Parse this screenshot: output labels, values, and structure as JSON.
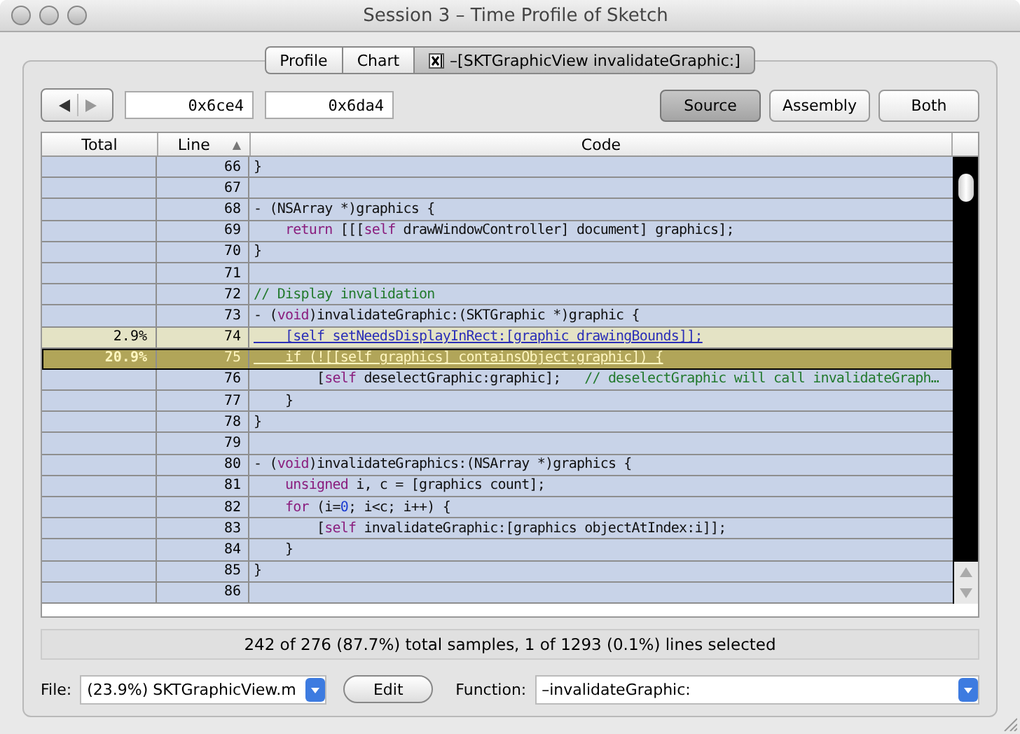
{
  "window": {
    "title": "Session 3 – Time Profile of Sketch"
  },
  "tabs": [
    {
      "label": "Profile",
      "selected": false,
      "closable": false
    },
    {
      "label": "Chart",
      "selected": false,
      "closable": false
    },
    {
      "label": "–[SKTGraphicView invalidateGraphic:]",
      "selected": true,
      "closable": true
    }
  ],
  "toolbar": {
    "address_from": "0x6ce4",
    "address_to": "0x6da4",
    "views": [
      {
        "label": "Source",
        "selected": true
      },
      {
        "label": "Assembly",
        "selected": false
      },
      {
        "label": "Both",
        "selected": false
      }
    ]
  },
  "table": {
    "columns": [
      {
        "label": "Total"
      },
      {
        "label": "Line",
        "sort": "▲"
      },
      {
        "label": "Code"
      }
    ],
    "rows": [
      {
        "line": "66",
        "selected": false,
        "sampled": false,
        "code": [
          {
            "text": "}",
            "kind": "plain"
          }
        ]
      },
      {
        "line": "67",
        "selected": false,
        "sampled": false
      },
      {
        "line": "68",
        "selected": false,
        "sampled": false,
        "code": [
          {
            "text": "- (NSArray *)graphics {",
            "kind": "plain"
          }
        ]
      },
      {
        "line": "69",
        "selected": false,
        "sampled": false,
        "code": [
          {
            "text": "    return",
            "kind": "keyword"
          },
          {
            "text": " [[[",
            "kind": "plain"
          },
          {
            "text": "self",
            "kind": "keyword"
          },
          {
            "text": " drawWindowController] document] graphics];",
            "kind": "plain"
          }
        ]
      },
      {
        "line": "70",
        "selected": false,
        "sampled": false,
        "code": [
          {
            "text": "}",
            "kind": "plain"
          }
        ]
      },
      {
        "line": "71",
        "selected": false,
        "sampled": false
      },
      {
        "line": "72",
        "selected": false,
        "sampled": false,
        "code": [
          {
            "text": "// Display invalidation",
            "kind": "comment"
          }
        ]
      },
      {
        "line": "73",
        "selected": false,
        "sampled": false,
        "code": [
          {
            "text": "- (",
            "kind": "plain"
          },
          {
            "text": "void",
            "kind": "keyword"
          },
          {
            "text": ")invalidateGraphic:(SKTGraphic *)graphic {",
            "kind": "plain"
          }
        ]
      },
      {
        "total": "2.9%",
        "line": "74",
        "selected": false,
        "sampled": true,
        "code": [
          {
            "text": "    [self setNeedsDisplayInRect:[graphic drawingBounds]];",
            "kind": "plain"
          }
        ]
      },
      {
        "total": "20.9%",
        "line": "75",
        "selected": true,
        "sampled": true,
        "code": [
          {
            "text": "    if (![[self graphics] containsObject:graphic]) {",
            "kind": "plain"
          }
        ]
      },
      {
        "line": "76",
        "selected": false,
        "sampled": false,
        "code": [
          {
            "text": "        [",
            "kind": "plain"
          },
          {
            "text": "self",
            "kind": "keyword"
          },
          {
            "text": " deselectGraphic:graphic];   ",
            "kind": "plain"
          },
          {
            "text": "// deselectGraphic will call invalidateGraph…",
            "kind": "comment"
          }
        ]
      },
      {
        "line": "77",
        "selected": false,
        "sampled": false,
        "code": [
          {
            "text": "    }",
            "kind": "plain"
          }
        ]
      },
      {
        "line": "78",
        "selected": false,
        "sampled": false,
        "code": [
          {
            "text": "}",
            "kind": "plain"
          }
        ]
      },
      {
        "line": "79",
        "selected": false,
        "sampled": false
      },
      {
        "line": "80",
        "selected": false,
        "sampled": false,
        "code": [
          {
            "text": "- (",
            "kind": "plain"
          },
          {
            "text": "void",
            "kind": "keyword"
          },
          {
            "text": ")invalidateGraphics:(NSArray *)graphics {",
            "kind": "plain"
          }
        ]
      },
      {
        "line": "81",
        "selected": false,
        "sampled": false,
        "code": [
          {
            "text": "    unsigned",
            "kind": "keyword"
          },
          {
            "text": " i, c = [graphics count];",
            "kind": "plain"
          }
        ]
      },
      {
        "line": "82",
        "selected": false,
        "sampled": false,
        "code": [
          {
            "text": "    for",
            "kind": "keyword"
          },
          {
            "text": " (i=",
            "kind": "plain"
          },
          {
            "text": "0",
            "kind": "number"
          },
          {
            "text": "; i<c; i++) {",
            "kind": "plain"
          }
        ]
      },
      {
        "line": "83",
        "selected": false,
        "sampled": false,
        "code": [
          {
            "text": "        [",
            "kind": "plain"
          },
          {
            "text": "self",
            "kind": "keyword"
          },
          {
            "text": " invalidateGraphic:[graphics objectAtIndex:i]];",
            "kind": "plain"
          }
        ]
      },
      {
        "line": "84",
        "selected": false,
        "sampled": false,
        "code": [
          {
            "text": "    }",
            "kind": "plain"
          }
        ]
      },
      {
        "line": "85",
        "selected": false,
        "sampled": false,
        "code": [
          {
            "text": "}",
            "kind": "plain"
          }
        ]
      },
      {
        "line": "86",
        "selected": false,
        "sampled": false
      }
    ]
  },
  "status_bar": "242 of 276 (87.7%) total samples, 1 of 1293 (0.1%) lines selected",
  "bottom": {
    "file_label": "File:",
    "file": "(23.9%) SKTGraphicView.m",
    "edit_button": "Edit",
    "function_label": "Function:",
    "function": "–invalidateGraphic:"
  }
}
